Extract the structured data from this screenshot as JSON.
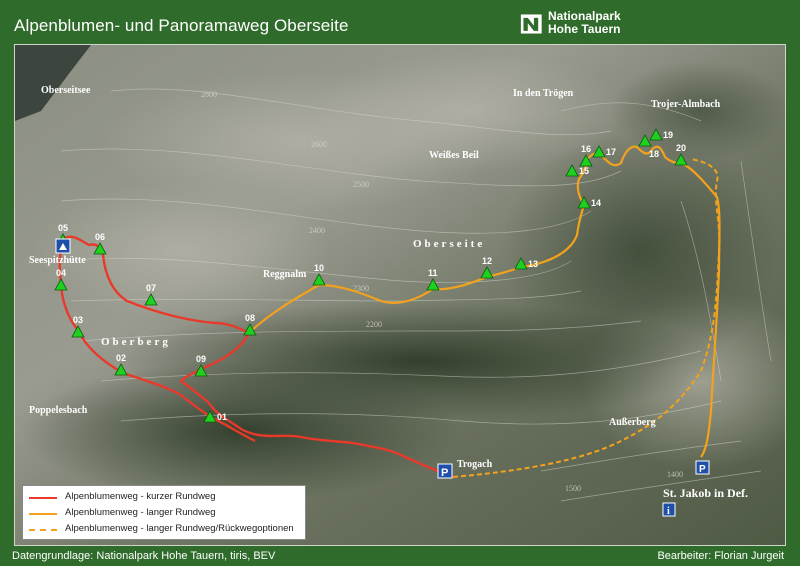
{
  "header": {
    "title": "Alpenblumen- und Panoramaweg Oberseite",
    "logo_line1": "Nationalpark",
    "logo_line2": "Hohe Tauern"
  },
  "footer": {
    "left": "Datengrundlage: Nationalpark Hohe Tauern, tiris, BEV",
    "right": "Bearbeiter: Florian Jurgeit"
  },
  "legend": [
    {
      "label": "Alpenblumenweg - kurzer Rundweg",
      "color": "#e8392b",
      "style": "solid"
    },
    {
      "label": "Alpenblumenweg - langer Rundweg",
      "color": "#f2a21c",
      "style": "solid"
    },
    {
      "label": "Alpenblumenweg - langer Rundweg/Rückwegoptionen",
      "color": "#f2a21c",
      "style": "dashed"
    }
  ],
  "place_names": {
    "oberseitsee": "Oberseitsee",
    "in_den_troegen": "In den Trögen",
    "trojer_almbach": "Trojer-Almbach",
    "weisses_beil": "Weißes Beil",
    "oberseite": "Oberseite",
    "seespitzhuette": "Seespitzhütte",
    "reggnalm": "Reggnalm",
    "oberberg": "Oberberg",
    "poppelesbach": "Poppelesbach",
    "ausserberg": "Außerberg",
    "trogach": "Trogach",
    "st_jakob": "St. Jakob in Def."
  },
  "contours": {
    "c2800": "2800",
    "c2600": "2600",
    "c2500": "2500",
    "c2400": "2400",
    "c2300": "2300",
    "c2200": "2200",
    "c1500": "1500",
    "c1400": "1400"
  },
  "waypoints": [
    "01",
    "02",
    "03",
    "04",
    "05",
    "06",
    "07",
    "08",
    "09",
    "10",
    "11",
    "12",
    "13",
    "14",
    "15",
    "16",
    "17",
    "18",
    "19",
    "20"
  ],
  "colors": {
    "route_short": "#e8392b",
    "route_long": "#f2a21c",
    "marker": "#1fd11f",
    "parking": "#1f4fa8",
    "frame": "#2f6b2a"
  }
}
